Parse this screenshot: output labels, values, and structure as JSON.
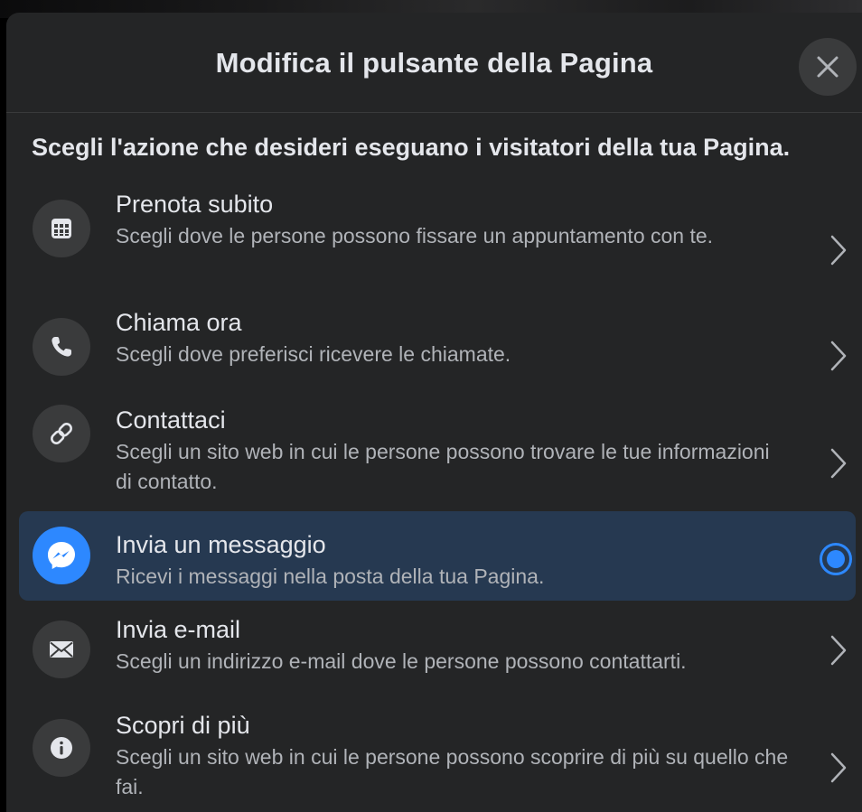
{
  "dialog": {
    "title": "Modifica il pulsante della Pagina",
    "close_icon": "close-icon",
    "subtitle": "Scegli l'azione che desideri eseguano i visitatori della tua Pagina."
  },
  "options": [
    {
      "title": "Prenota subito",
      "description": "Scegli dove le persone possono fissare un appuntamento con te.",
      "icon": "calendar-icon",
      "selected": false
    },
    {
      "title": "Chiama ora",
      "description": "Scegli dove preferisci ricevere le chiamate.",
      "icon": "phone-icon",
      "selected": false
    },
    {
      "title": "Contattaci",
      "description": "Scegli un sito web in cui le persone possono trovare le tue informazioni di contatto.",
      "icon": "link-icon",
      "selected": false
    },
    {
      "title": "Invia un messaggio",
      "description": "Ricevi i messaggi nella posta della tua Pagina.",
      "icon": "messenger-icon",
      "selected": true
    },
    {
      "title": "Invia e-mail",
      "description": "Scegli un indirizzo e-mail dove le persone possono contattarti.",
      "icon": "envelope-icon",
      "selected": false
    },
    {
      "title": "Scopri di più",
      "description": "Scegli un sito web in cui le persone possono scoprire di più su quello che fai.",
      "icon": "info-icon",
      "selected": false
    }
  ],
  "colors": {
    "dialog_background": "#242526",
    "primary_text": "#e4e6eb",
    "secondary_text": "#b0b3b8",
    "icon_circle": "#3a3b3c",
    "accent": "#2d88ff",
    "selected_row": "#263951"
  }
}
